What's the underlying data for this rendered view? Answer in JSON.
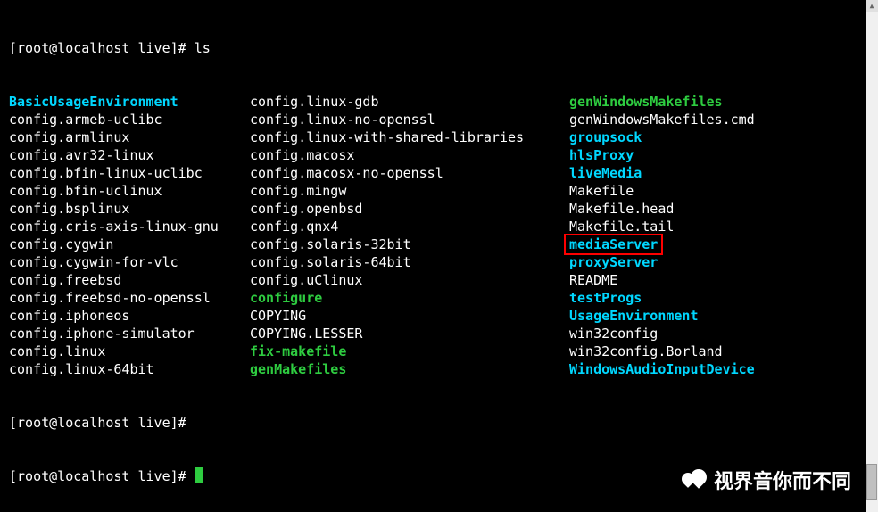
{
  "prompt1": "[root@localhost live]# ls",
  "prompt2": "[root@localhost live]#",
  "prompt3": "[root@localhost live]# ",
  "col1": [
    {
      "t": "BasicUsageEnvironment",
      "c": "cyan"
    },
    {
      "t": "config.armeb-uclibc",
      "c": "white"
    },
    {
      "t": "config.armlinux",
      "c": "white"
    },
    {
      "t": "config.avr32-linux",
      "c": "white"
    },
    {
      "t": "config.bfin-linux-uclibc",
      "c": "white"
    },
    {
      "t": "config.bfin-uclinux",
      "c": "white"
    },
    {
      "t": "config.bsplinux",
      "c": "white"
    },
    {
      "t": "config.cris-axis-linux-gnu",
      "c": "white"
    },
    {
      "t": "config.cygwin",
      "c": "white"
    },
    {
      "t": "config.cygwin-for-vlc",
      "c": "white"
    },
    {
      "t": "config.freebsd",
      "c": "white"
    },
    {
      "t": "config.freebsd-no-openssl",
      "c": "white"
    },
    {
      "t": "config.iphoneos",
      "c": "white"
    },
    {
      "t": "config.iphone-simulator",
      "c": "white"
    },
    {
      "t": "config.linux",
      "c": "white"
    },
    {
      "t": "config.linux-64bit",
      "c": "white"
    }
  ],
  "col2": [
    {
      "t": "config.linux-gdb",
      "c": "white"
    },
    {
      "t": "config.linux-no-openssl",
      "c": "white"
    },
    {
      "t": "config.linux-with-shared-libraries",
      "c": "white"
    },
    {
      "t": "config.macosx",
      "c": "white"
    },
    {
      "t": "config.macosx-no-openssl",
      "c": "white"
    },
    {
      "t": "config.mingw",
      "c": "white"
    },
    {
      "t": "config.openbsd",
      "c": "white"
    },
    {
      "t": "config.qnx4",
      "c": "white"
    },
    {
      "t": "config.solaris-32bit",
      "c": "white"
    },
    {
      "t": "config.solaris-64bit",
      "c": "white"
    },
    {
      "t": "config.uClinux",
      "c": "white"
    },
    {
      "t": "configure",
      "c": "green"
    },
    {
      "t": "COPYING",
      "c": "white"
    },
    {
      "t": "COPYING.LESSER",
      "c": "white"
    },
    {
      "t": "fix-makefile",
      "c": "green"
    },
    {
      "t": "genMakefiles",
      "c": "green"
    }
  ],
  "col3": [
    {
      "t": "genWindowsMakefiles",
      "c": "green"
    },
    {
      "t": "genWindowsMakefiles.cmd",
      "c": "white"
    },
    {
      "t": "groupsock",
      "c": "cyan"
    },
    {
      "t": "hlsProxy",
      "c": "cyan"
    },
    {
      "t": "liveMedia",
      "c": "cyan"
    },
    {
      "t": "Makefile",
      "c": "white"
    },
    {
      "t": "Makefile.head",
      "c": "white"
    },
    {
      "t": "Makefile.tail",
      "c": "white"
    },
    {
      "t": "mediaServer",
      "c": "cyan",
      "hl": true
    },
    {
      "t": "proxyServer",
      "c": "cyan"
    },
    {
      "t": "README",
      "c": "white"
    },
    {
      "t": "testProgs",
      "c": "cyan"
    },
    {
      "t": "UsageEnvironment",
      "c": "cyan"
    },
    {
      "t": "win32config",
      "c": "white"
    },
    {
      "t": "win32config.Borland",
      "c": "white"
    },
    {
      "t": "WindowsAudioInputDevice",
      "c": "cyan"
    }
  ],
  "watermark_text": "视界音你而不同"
}
